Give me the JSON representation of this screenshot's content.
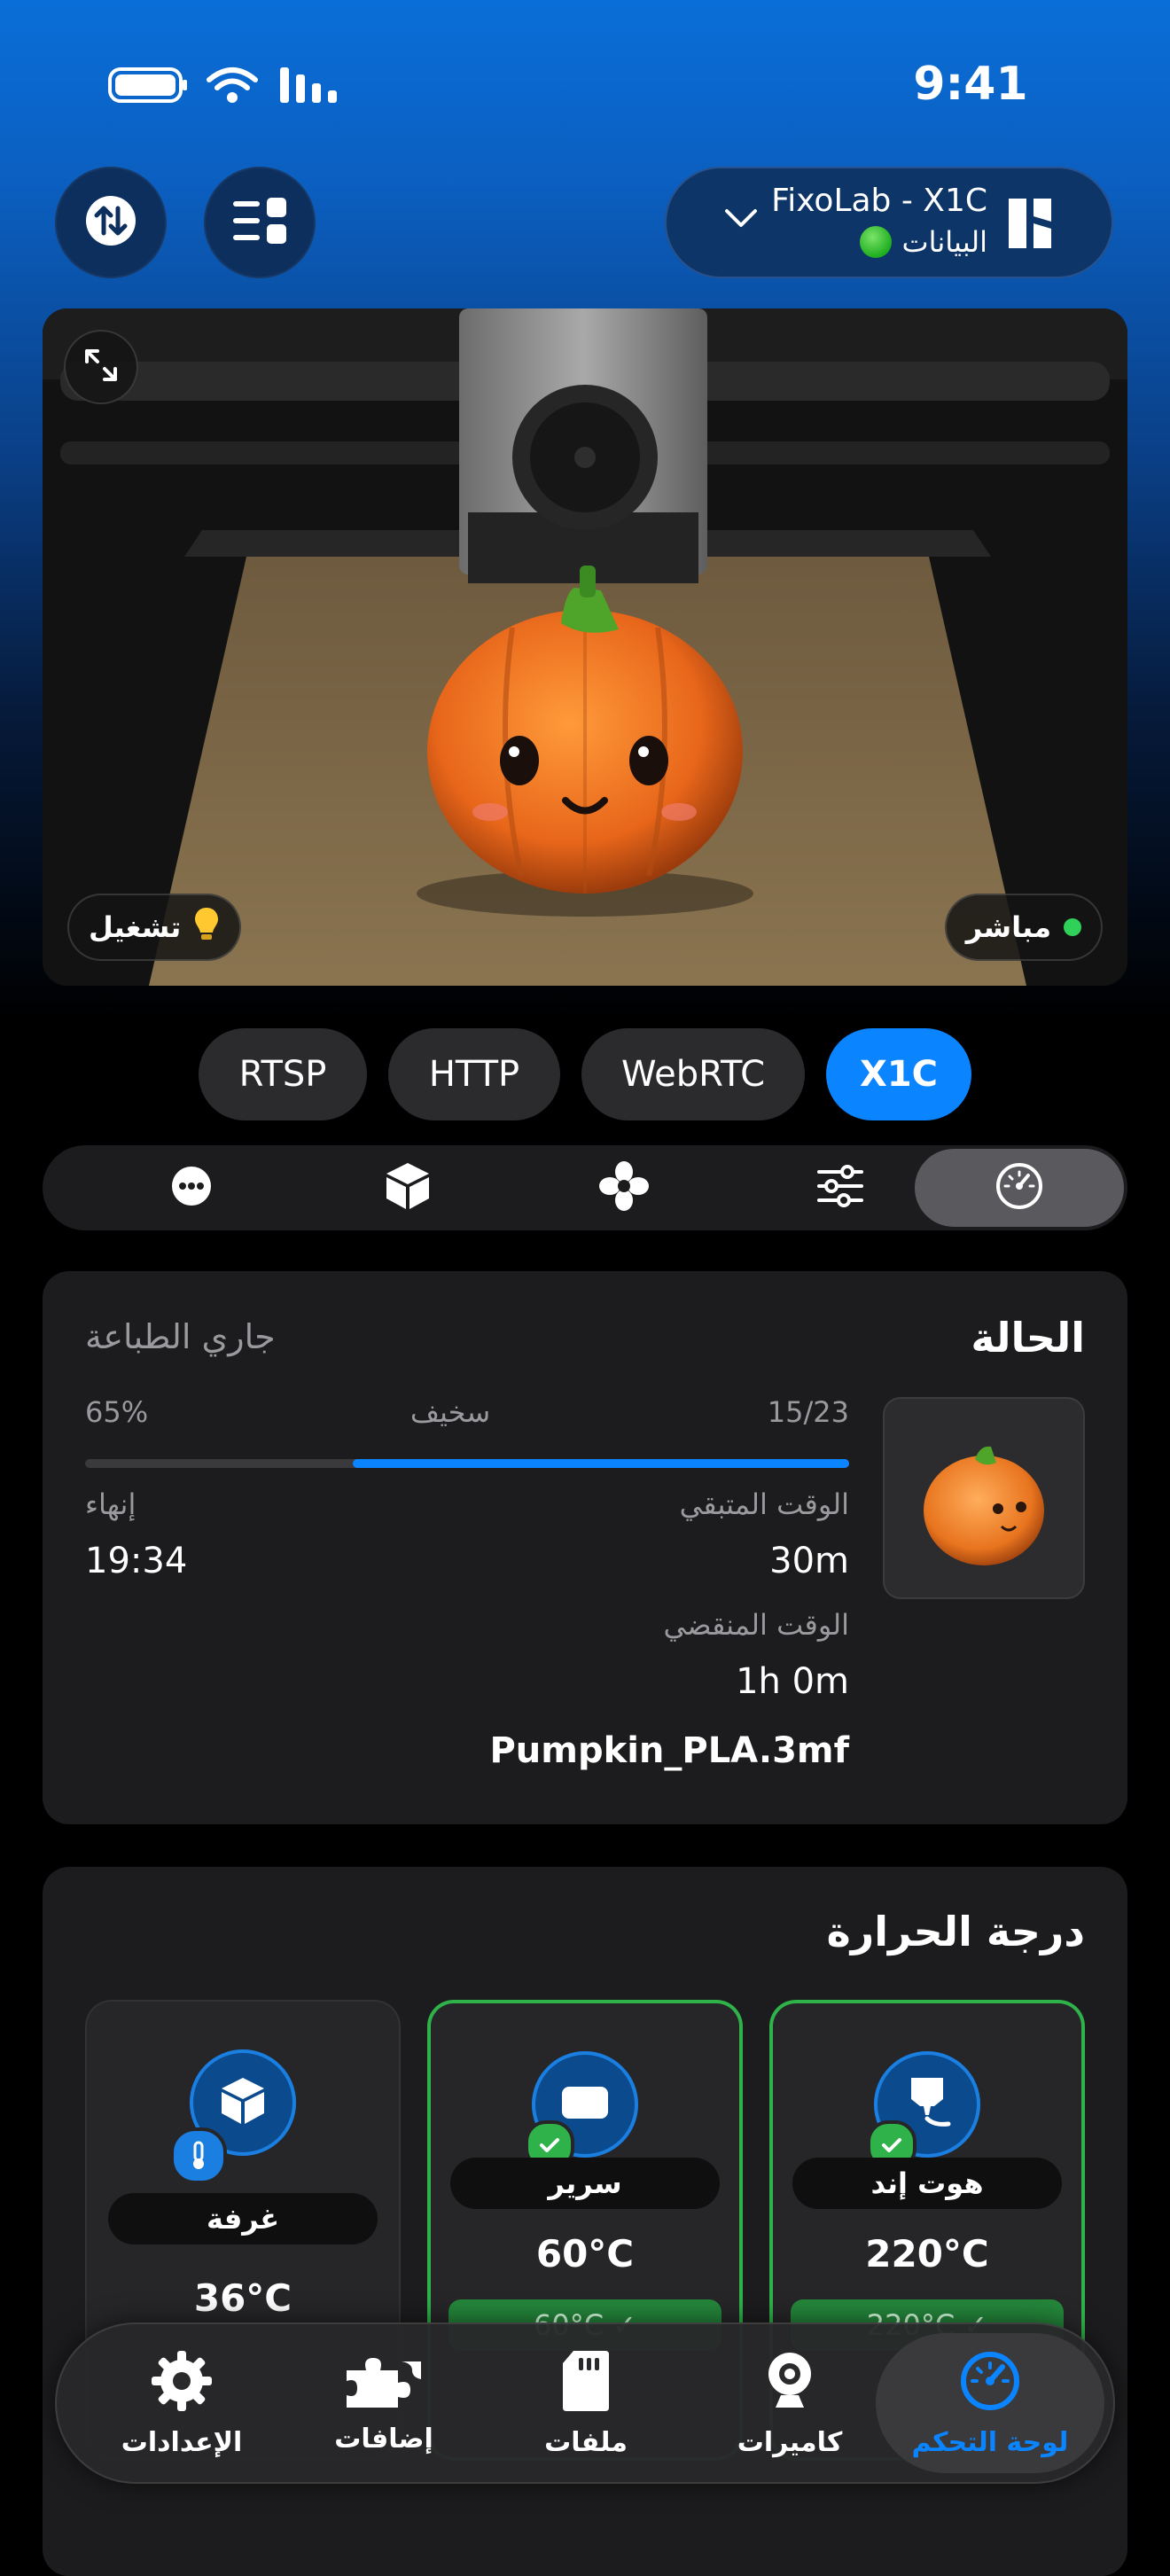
{
  "status_bar": {
    "time": "9:41"
  },
  "header": {
    "printer_name": "FixoLab - X1C",
    "printer_status": "البيانات",
    "sort_icon": "arrow-up-down-icon",
    "menu_icon": "list-grid-icon",
    "printer_icon": "printer-logo-icon"
  },
  "camera": {
    "live_label": "مباشر",
    "light_label": "تشغيل",
    "expand_icon": "expand-icon"
  },
  "stream_tabs": [
    "RTSP",
    "HTTP",
    "WebRTC",
    "X1C"
  ],
  "active_stream": "X1C",
  "segments": [
    "more-icon",
    "box-icon",
    "fan-icon",
    "sliders-icon",
    "gauge-icon"
  ],
  "status": {
    "title": "الحالة",
    "state": "جاري الطباعة",
    "layers": "15/23",
    "quality": "سخيف",
    "percent_label": "65%",
    "progress": 0.65,
    "remaining_label": "الوقت المتبقي",
    "remaining_value": "30m",
    "finish_label": "إنهاء",
    "finish_value": "19:34",
    "elapsed_label": "الوقت المنقضي",
    "elapsed_value": "1h 0m",
    "filename": "Pumpkin_PLA.3mf"
  },
  "temperature": {
    "title": "درجة الحرارة",
    "tiles": [
      {
        "name": "هوت إند",
        "temp": "220°C",
        "target": "220°C ✓"
      },
      {
        "name": "سرير",
        "temp": "60°C",
        "target": "60°C ✓"
      },
      {
        "name": "غرفة",
        "temp": "36°C"
      }
    ]
  },
  "tabbar": {
    "items": [
      {
        "label": "لوحة التحكم",
        "icon": "gauge-icon"
      },
      {
        "label": "كاميرات",
        "icon": "webcam-icon"
      },
      {
        "label": "ملفات",
        "icon": "sd-card-icon"
      },
      {
        "label": "إضافات",
        "icon": "puzzle-icon"
      },
      {
        "label": "الإعدادات",
        "icon": "gear-icon"
      }
    ]
  },
  "colors": {
    "accent": "#0a84ff",
    "ok": "#2fb24a",
    "card": "#1c1c1e"
  }
}
